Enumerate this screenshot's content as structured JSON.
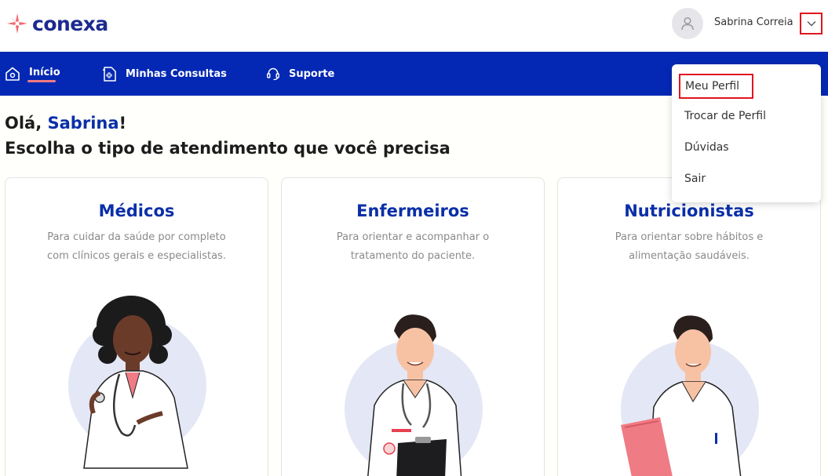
{
  "brand": {
    "name": "conexa",
    "color": "#1c2a8f",
    "accent": "#f06a73"
  },
  "header": {
    "user_name": "Sabrina Correia",
    "avatar_icon": "user-icon",
    "dropdown_icon": "chevron-down-icon"
  },
  "nav": {
    "items": [
      {
        "label": "Início",
        "icon": "home-icon",
        "active": true
      },
      {
        "label": "Minhas Consultas",
        "icon": "medical-file-icon",
        "active": false
      },
      {
        "label": "Suporte",
        "icon": "headset-icon",
        "active": false
      }
    ],
    "background": "#0428b4"
  },
  "greeting": {
    "hello": "Olá,",
    "name": "Sabrina",
    "exclaim": "!",
    "subtitle": "Escolha o tipo de atendimento que você precisa"
  },
  "cards": [
    {
      "title": "Médicos",
      "desc_line1": "Para cuidar da saúde por completo",
      "desc_line2": "com clínicos gerais e especialistas."
    },
    {
      "title": "Enfermeiros",
      "desc_line1": "Para orientar e acompanhar o",
      "desc_line2": "tratamento do paciente."
    },
    {
      "title": "Nutricionistas",
      "desc_line1": "Para orientar sobre hábitos e",
      "desc_line2": "alimentação saudáveis."
    }
  ],
  "menu": {
    "items": [
      "Meu Perfil",
      "Trocar de Perfil",
      "Dúvidas",
      "Sair"
    ]
  }
}
